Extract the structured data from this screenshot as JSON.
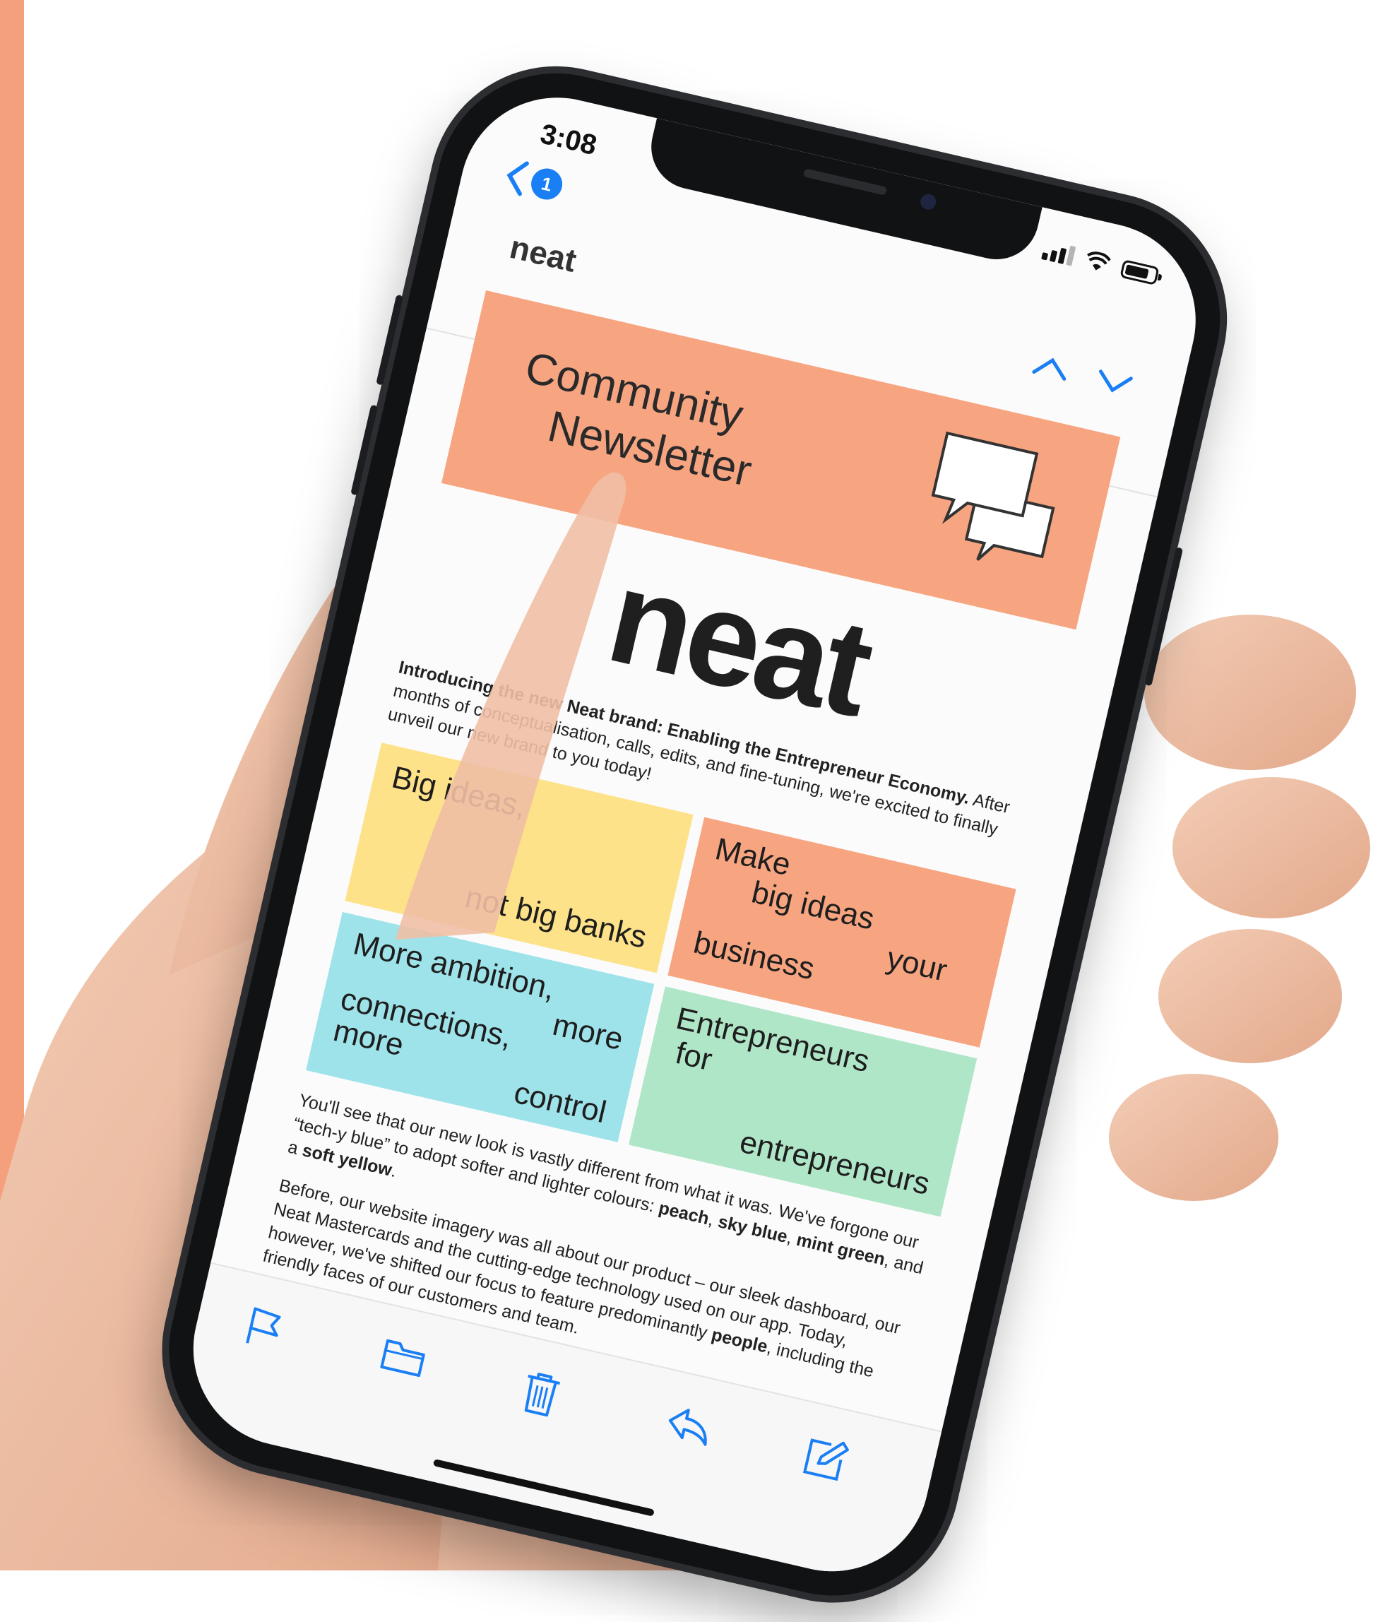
{
  "status": {
    "time": "3:08"
  },
  "nav": {
    "back_badge": "1",
    "sender": "neat"
  },
  "banner": {
    "line1": "Community",
    "line2": "Newsletter"
  },
  "logo": "neat",
  "intro": {
    "bold": "Introducing the new Neat brand: Enabling the Entrepreneur Economy.",
    "rest": " After months of conceptualisation, calls, edits, and fine-tuning, we're excited to finally unveil our new brand to you today!"
  },
  "tiles": {
    "yellow": {
      "a": "Big ideas,",
      "b": "not big banks"
    },
    "peach": {
      "a": "Make",
      "b": "big ideas",
      "c": "your",
      "d": "business"
    },
    "blue": {
      "a": "More ambition,",
      "b": "more",
      "c": "connections,",
      "d": "more",
      "e": "control"
    },
    "green": {
      "a": "Entrepreneurs",
      "b": "for",
      "c": "entrepreneurs"
    }
  },
  "para1": {
    "t1": "You'll see that our new look is vastly different from what it was. We've forgone our “tech-y blue” to adopt softer and lighter colours: ",
    "peach": "peach",
    "sep1": ", ",
    "skyblue": "sky blue",
    "sep2": ", ",
    "mint": "mint green",
    "t2": ", and a ",
    "yellow": "soft yellow",
    "t3": "."
  },
  "para2": {
    "t1": "Before, our website imagery was all about our product – our sleek dashboard, our Neat Mastercards and the cutting-edge technology used on our app. Today, however, we've shifted our focus to feature predominantly ",
    "people": "people",
    "t2": ", including the friendly faces of our customers and team."
  },
  "colors": {
    "accent": "#f5a07c",
    "link_blue": "#1a7ff5",
    "peach": "#f7a581",
    "yellow": "#fde289",
    "sky_blue": "#9fe3ea",
    "mint_green": "#b0e6c8"
  },
  "toolbar": {
    "icons": [
      "flag-icon",
      "folder-icon",
      "trash-icon",
      "reply-icon",
      "compose-icon"
    ]
  }
}
